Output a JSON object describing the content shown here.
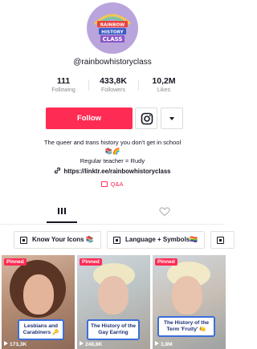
{
  "profile": {
    "avatar_text": "RAINBOW HISTORY CLASS",
    "username": "@rainbowhistoryclass"
  },
  "stats": [
    {
      "value": "111",
      "label": "Following"
    },
    {
      "value": "433,8K",
      "label": "Followers"
    },
    {
      "value": "10,2M",
      "label": "Likes"
    }
  ],
  "actions": {
    "follow_label": "Follow",
    "instagram_icon": "instagram-icon",
    "more_icon": "caret-down-icon"
  },
  "bio": {
    "line1": "The queer and trans history you don't get in school",
    "line2": "📚🌈",
    "line3": "Regular teacher = Rudy",
    "link": "https://linktr.ee/rainbowhistoryclass",
    "qa_label": "Q&A"
  },
  "tabs": [
    {
      "icon": "grid-icon",
      "selected": true
    },
    {
      "icon": "liked-heart-icon",
      "selected": false
    }
  ],
  "playlists": [
    {
      "label": "Know Your Icons 📚"
    },
    {
      "label": "Language + Symbols🏳️‍🌈"
    },
    {
      "label": ""
    }
  ],
  "videos": [
    {
      "badge": "Pinned",
      "caption": "Lesbians and Carabiners 🔑",
      "views": "173,3K"
    },
    {
      "badge": "Pinned",
      "caption": "The History of the Gay Earring",
      "views": "248,8K"
    },
    {
      "badge": "Pinned",
      "caption": "The History of the Term 'Fruity' 🍋",
      "views": "3,8M"
    }
  ],
  "colors": {
    "accent": "#fe2c55",
    "avatar_bg": "#b9a4dc",
    "caption_border": "#3b6fd8",
    "caption_text": "#1c2f78"
  }
}
